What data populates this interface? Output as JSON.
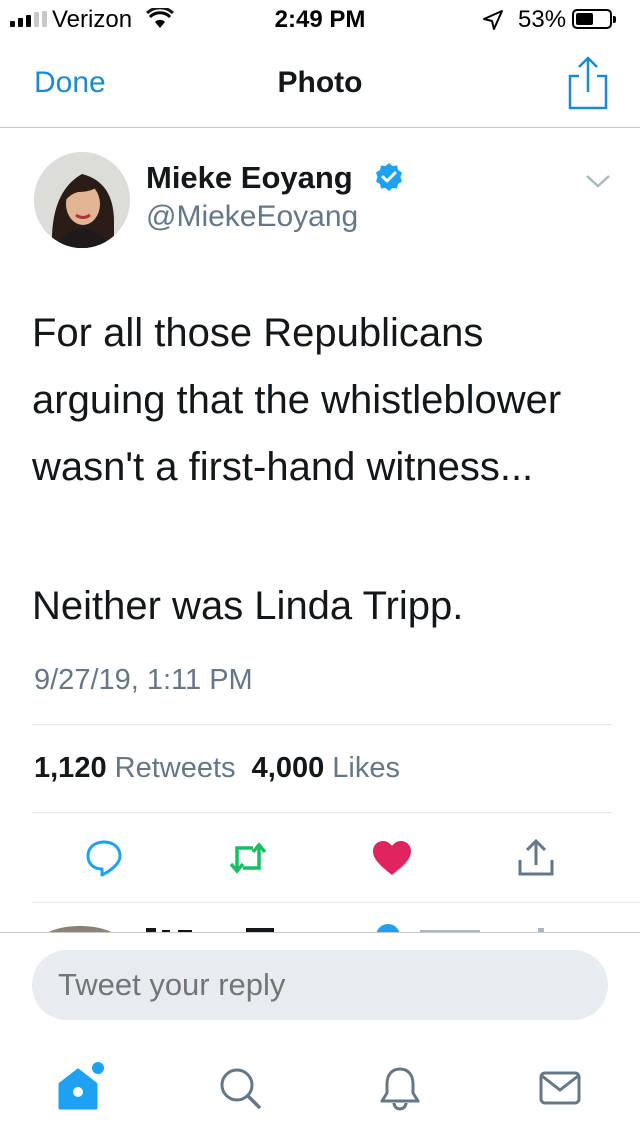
{
  "status_bar": {
    "carrier": "Verizon",
    "time": "2:49 PM",
    "battery": "53%",
    "battery_level": 0.53
  },
  "nav": {
    "done_label": "Done",
    "title": "Photo"
  },
  "tweet": {
    "author_name": "Mieke Eoyang",
    "handle": "@MiekeEoyang",
    "text_paragraph_1": "For all those Republicans arguing that the whistleblower wasn't a first-hand witness...",
    "text_paragraph_2": "Neither was Linda Tripp.",
    "timestamp": "9/27/19, 1:11 PM",
    "retweets_count": "1,120",
    "retweets_label": "Retweets",
    "likes_count": "4,000",
    "likes_label": "Likes"
  },
  "reply": {
    "placeholder": "Tweet your reply"
  },
  "icons": {
    "accent": "#1da1f2",
    "retweet_color": "#17bf63",
    "like_color": "#e0245e",
    "muted": "#657786"
  }
}
